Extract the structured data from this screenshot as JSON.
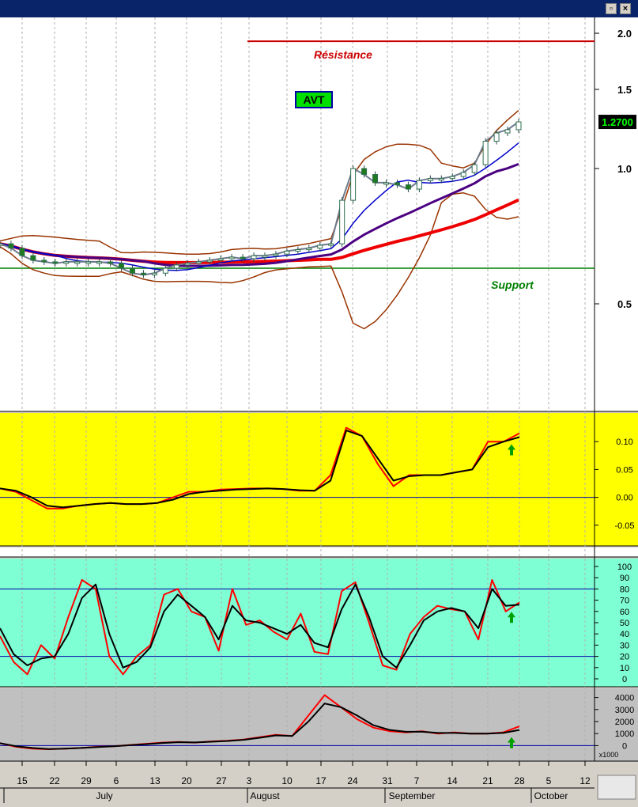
{
  "chart_data": [
    {
      "type": "candlestick",
      "title": "AVT",
      "scale": "log",
      "ylim": [
        0.3,
        2.1
      ],
      "y_ticks": [
        "2.0",
        "1.5",
        "1.0",
        "0.5"
      ],
      "last_price_label": "1.2700",
      "annotations": {
        "resistance": "Résistance",
        "support": "Support"
      },
      "levels": {
        "resistance": 1.92,
        "support": 0.6
      },
      "colors": {
        "resistance": "#cc0000",
        "support": "#008000",
        "ma_short": "#0000cc",
        "ma_mid": "#4b0082",
        "ma_long": "#ee0000",
        "bollinger": "#993300",
        "price": "#6d7b8d"
      },
      "price_close": [
        0.68,
        0.665,
        0.64,
        0.625,
        0.62,
        0.615,
        0.62,
        0.62,
        0.62,
        0.62,
        0.615,
        0.6,
        0.585,
        0.58,
        0.585,
        0.6,
        0.61,
        0.615,
        0.62,
        0.625,
        0.63,
        0.635,
        0.63,
        0.64,
        0.64,
        0.645,
        0.655,
        0.66,
        0.665,
        0.675,
        0.68,
        0.85,
        1.0,
        0.97,
        0.93,
        0.93,
        0.92,
        0.9,
        0.94,
        0.95,
        0.95,
        0.96,
        0.98,
        1.02,
        1.15,
        1.2,
        1.22,
        1.27
      ]
    },
    {
      "type": "line",
      "panel": "momentum",
      "y_ticks": [
        "0.10",
        "0.05",
        "0.00",
        "-0.05"
      ],
      "ylim": [
        -0.08,
        0.14
      ],
      "series": [
        {
          "color": "#ff0000",
          "values": [
            0.016,
            0.01,
            -0.005,
            -0.02,
            -0.02,
            -0.015,
            -0.012,
            -0.01,
            -0.012,
            -0.012,
            -0.01,
            0.0,
            0.01,
            0.01,
            0.014,
            0.015,
            0.016,
            0.016,
            0.015,
            0.012,
            0.012,
            0.04,
            0.125,
            0.11,
            0.06,
            0.02,
            0.04,
            0.04,
            0.04,
            0.045,
            0.05,
            0.1,
            0.1,
            0.115
          ]
        },
        {
          "color": "#000000",
          "values": [
            0.016,
            0.012,
            0.0,
            -0.015,
            -0.018,
            -0.015,
            -0.012,
            -0.01,
            -0.012,
            -0.012,
            -0.01,
            -0.004,
            0.006,
            0.01,
            0.012,
            0.014,
            0.015,
            0.016,
            0.015,
            0.013,
            0.012,
            0.03,
            0.12,
            0.11,
            0.07,
            0.03,
            0.038,
            0.04,
            0.04,
            0.045,
            0.05,
            0.09,
            0.1,
            0.108
          ]
        }
      ],
      "signal_arrow": "up"
    },
    {
      "type": "line",
      "panel": "stochastic",
      "y_ticks": [
        "100",
        "90",
        "80",
        "70",
        "60",
        "50",
        "40",
        "30",
        "20",
        "10",
        "0"
      ],
      "ylim": [
        0,
        100
      ],
      "levels": [
        80,
        20
      ],
      "series": [
        {
          "color": "#ff0000",
          "values": [
            38,
            15,
            4,
            30,
            18,
            55,
            88,
            80,
            20,
            4,
            20,
            30,
            75,
            80,
            60,
            55,
            25,
            80,
            48,
            52,
            42,
            35,
            58,
            24,
            22,
            78,
            86,
            50,
            12,
            8,
            40,
            55,
            65,
            62,
            60,
            35,
            88,
            60,
            68
          ]
        },
        {
          "color": "#000000",
          "values": [
            45,
            22,
            12,
            18,
            20,
            40,
            72,
            84,
            40,
            10,
            15,
            28,
            60,
            75,
            65,
            55,
            35,
            65,
            52,
            50,
            45,
            40,
            48,
            32,
            28,
            62,
            84,
            55,
            20,
            10,
            30,
            52,
            60,
            63,
            60,
            45,
            80,
            65,
            66
          ]
        }
      ],
      "signal_arrow": "up"
    },
    {
      "type": "line",
      "panel": "volume_oscillator",
      "y_ticks": [
        "4000",
        "3000",
        "2000",
        "1000",
        "0"
      ],
      "ylim": [
        -500,
        4500
      ],
      "multiplier_label": "x1000",
      "series": [
        {
          "color": "#ff0000",
          "values": [
            200,
            -100,
            -250,
            -300,
            -250,
            -200,
            -100,
            -50,
            50,
            150,
            250,
            300,
            250,
            350,
            400,
            500,
            700,
            900,
            800,
            2500,
            4200,
            3200,
            2200,
            1500,
            1200,
            1100,
            1200,
            1000,
            1100,
            1000,
            1000,
            1100,
            1600
          ]
        },
        {
          "color": "#000000",
          "values": [
            200,
            -50,
            -200,
            -280,
            -250,
            -200,
            -120,
            -60,
            30,
            120,
            220,
            280,
            260,
            320,
            380,
            480,
            650,
            850,
            800,
            2000,
            3500,
            3200,
            2500,
            1700,
            1300,
            1150,
            1150,
            1050,
            1050,
            1000,
            1000,
            1050,
            1300
          ]
        }
      ],
      "signal_arrow": "up"
    }
  ],
  "x_axis": {
    "day_labels": [
      "15",
      "22",
      "29",
      "6",
      "13",
      "20",
      "27",
      "3",
      "10",
      "17",
      "24",
      "31",
      "7",
      "14",
      "21",
      "28",
      "5",
      "12"
    ],
    "months": [
      "July",
      "August",
      "September",
      "October"
    ]
  },
  "window": {
    "restore_icon": "restore-icon",
    "close_label": "×"
  }
}
